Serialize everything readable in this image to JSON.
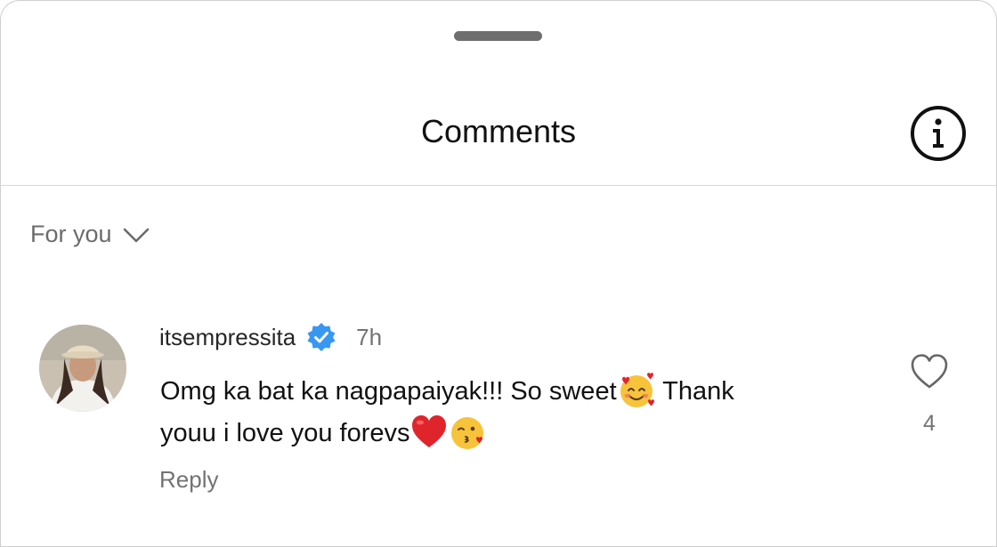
{
  "header": {
    "title": "Comments",
    "info_icon": "info-circle-icon"
  },
  "filter": {
    "label": "For you",
    "icon": "chevron-down-icon"
  },
  "comments": [
    {
      "username": "itsempressita",
      "verified": true,
      "time": "7h",
      "text_line1": "Omg ka bat ka nagpapaiyak!!! So sweet",
      "text_line1_after_emoji": " Thank",
      "text_line2": "youu i love you forevs",
      "emojis": [
        "smiling-face-with-hearts",
        "red-heart",
        "face-blowing-a-kiss"
      ],
      "reply_label": "Reply",
      "like_count": "4",
      "like_icon": "heart-outline-icon"
    }
  ],
  "colors": {
    "verified_blue": "#3897f0",
    "muted_text": "#737373",
    "heart_red": "#e0242c"
  }
}
